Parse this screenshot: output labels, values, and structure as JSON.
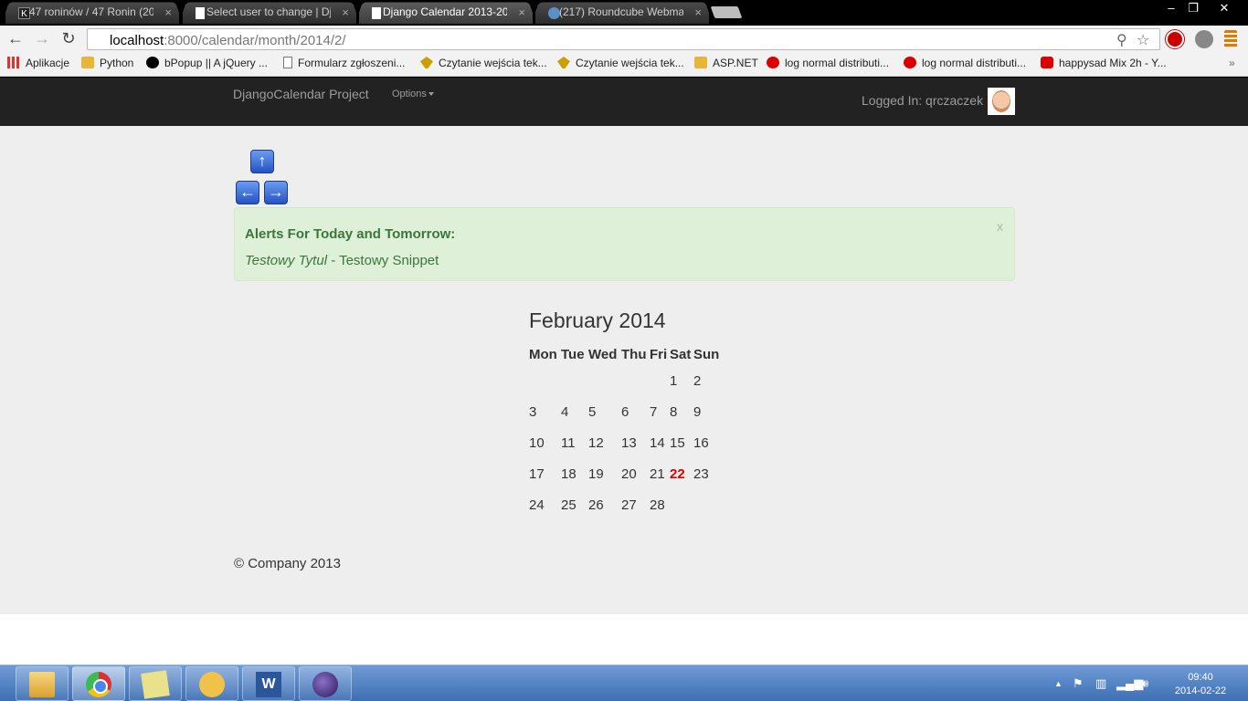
{
  "browser": {
    "tabs": [
      {
        "label": "47 roninów / 47 Ronin (20",
        "favicon": "K",
        "active": false
      },
      {
        "label": "Select user to change | Dja",
        "favicon": "",
        "active": false
      },
      {
        "label": "Django Calendar 2013-201",
        "favicon": "",
        "active": true
      },
      {
        "label": "(217) Roundcube Webmai",
        "favicon": "",
        "active": false
      }
    ],
    "window_controls": {
      "minimize": "–",
      "maximize": "❐",
      "close": "✕"
    },
    "url_host": "localhost",
    "url_rest": ":8000/calendar/month/2014/2/",
    "bookmarks": [
      {
        "label": "Aplikacje",
        "icon": "apps-icon"
      },
      {
        "label": "Python",
        "icon": "folder-icon"
      },
      {
        "label": "bPopup || A jQuery ...",
        "icon": "bpopup-icon"
      },
      {
        "label": "Formularz zgłoszeni...",
        "icon": "page-icon"
      },
      {
        "label": "Czytanie wejścia tek...",
        "icon": "plant-icon"
      },
      {
        "label": "Czytanie wejścia tek...",
        "icon": "plant-icon"
      },
      {
        "label": "ASP.NET",
        "icon": "folder-icon"
      },
      {
        "label": "log normal distributi...",
        "icon": "red-circle-icon"
      },
      {
        "label": "log normal distributi...",
        "icon": "red-circle-icon"
      },
      {
        "label": "happysad Mix 2h - Y...",
        "icon": "youtube-icon"
      }
    ],
    "bookmarks_overflow": "»"
  },
  "navbar": {
    "brand": "DjangoCalendar Project",
    "options": "Options",
    "login": "Logged In: qrczaczek"
  },
  "alert": {
    "title": "Alerts For Today and Tomorrow:",
    "item_title": "Testowy Tytul",
    "item_separator": " - ",
    "item_snippet": "Testowy Snippet",
    "close": "x"
  },
  "calendar": {
    "month_title": "February 2014",
    "weekdays": [
      "Mon",
      "Tue",
      "Wed",
      "Thu",
      "Fri",
      "Sat",
      "Sun"
    ],
    "weeks": [
      [
        "",
        "",
        "",
        "",
        "",
        "1",
        "2"
      ],
      [
        "3",
        "4",
        "5",
        "6",
        "7",
        "8",
        "9"
      ],
      [
        "10",
        "11",
        "12",
        "13",
        "14",
        "15",
        "16"
      ],
      [
        "17",
        "18",
        "19",
        "20",
        "21",
        "22",
        "23"
      ],
      [
        "24",
        "25",
        "26",
        "27",
        "28",
        "",
        ""
      ]
    ],
    "today": "22",
    "today_color": "#dd0000"
  },
  "footer": "© Company 2013",
  "taskbar": {
    "apps": [
      "file-explorer-icon",
      "chrome-icon",
      "sticky-notes-icon",
      "outlook-icon",
      "word-icon",
      "eclipse-icon"
    ],
    "word_letter": "W",
    "time": "09:40",
    "date": "2014-02-22"
  }
}
